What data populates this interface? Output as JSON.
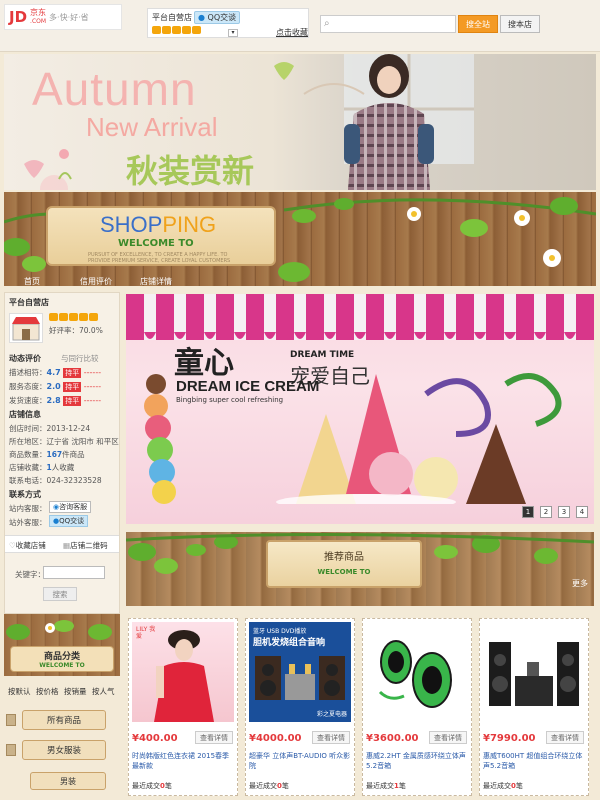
{
  "header": {
    "logo_jd": "JD",
    "logo_cn": "京东",
    "logo_com": ".COM",
    "slogan": "多·快·好·省",
    "shop_label": "平台自营店",
    "qq_label": "QQ交谈",
    "collect_label": "点击收藏",
    "search_placeholder": "",
    "search_all_label": "搜全站",
    "search_shop_label": "搜本店"
  },
  "hero": {
    "line1": "Autumn",
    "line2": "New Arrival",
    "line3": "秋装赏新"
  },
  "shop_banner": {
    "shopping_a": "SHOP",
    "shopping_b": "PING",
    "welcome": "WELCOME TO",
    "small": "PURSUIT OF EXCELLENCE, TO CREATE A HAPPY LIFE. TO PROVIDE PREMIUM SERVICE, CREATE LOYAL CUSTOMERS"
  },
  "nav": {
    "items": [
      "首页",
      "信用评价",
      "店铺详情"
    ]
  },
  "shop_info": {
    "title": "平台自营店",
    "good_rate_label": "好评率：",
    "good_rate": "70.0%",
    "dynamic_title": "动态评价",
    "compare_label": "与同行比较",
    "ratings": [
      {
        "label": "描述相符：",
        "score": "4.7",
        "status": "持平",
        "dash": "------"
      },
      {
        "label": "服务态度：",
        "score": "2.0",
        "status": "持平",
        "dash": "------"
      },
      {
        "label": "发货速度：",
        "score": "2.8",
        "status": "持平",
        "dash": "------"
      }
    ],
    "info_title": "店铺信息",
    "created": "创店时间：2013-12-24",
    "location": "所在地区：辽宁省 沈阳市 和平区",
    "goods_count_label": "商品数量：",
    "goods_count": "167",
    "goods_count_unit": "件商品",
    "fans_label": "店铺收藏：",
    "fans": "1",
    "fans_unit": "人收藏",
    "phone": "联系电话：024-32323528",
    "contact_title": "联系方式",
    "cs_inside_label": "站内客服：",
    "cs_inside_btn": "咨询客服",
    "cs_outside_label": "站外客服：",
    "cs_outside_btn": "QQ交谈",
    "tab_fav": "收藏店铺",
    "tab_qr": "店铺二维码",
    "keyword_label": "关键字：",
    "keyword_value": "",
    "search_btn": "搜索"
  },
  "slider": {
    "title_cn": "童心",
    "dream_time": "DREAM TIME",
    "pet_cn": "宠爱自己",
    "dream_ice": "DREAM ICE CREAM",
    "bingbing": "Bingbing super cool refreshing",
    "pages": [
      "1",
      "2",
      "3",
      "4"
    ],
    "active_page": 1
  },
  "recommend": {
    "title": "推荐商品",
    "welcome": "WELCOME TO",
    "more": "更多"
  },
  "category": {
    "title": "商品分类",
    "welcome": "WELCOME TO",
    "sorts": [
      "按默认",
      "按价格",
      "按销量",
      "按人气"
    ],
    "items": [
      "所有商品",
      "男女服装",
      "男装"
    ]
  },
  "products": [
    {
      "price": "¥400.00",
      "detail": "查看详情",
      "name": "时尚韩版红色连衣裙 2015春季最新款",
      "sold_label": "最近成交",
      "sold": "0",
      "sold_unit": "笔",
      "img_text": "LILY 我爱"
    },
    {
      "price": "¥4000.00",
      "detail": "查看详情",
      "name": "超豪华 立体声BT-AUDIO 听众影院",
      "sold_label": "最近成交",
      "sold": "0",
      "sold_unit": "笔",
      "img_text_top": "蓝牙 USB DVD播放",
      "img_text": "胆机发烧组合音响",
      "img_text_bottom": "彩之夏电器"
    },
    {
      "price": "¥3600.00",
      "detail": "查看详情",
      "name": "惠威2.2HT 金属质感环绕立体声 5.2音箱",
      "sold_label": "最近成交",
      "sold": "1",
      "sold_unit": "笔"
    },
    {
      "price": "¥7990.00",
      "detail": "查看详情",
      "name": "惠威T600HT 超值组合环绕立体声5.2音箱",
      "sold_label": "最近成交",
      "sold": "0",
      "sold_unit": "笔"
    }
  ]
}
